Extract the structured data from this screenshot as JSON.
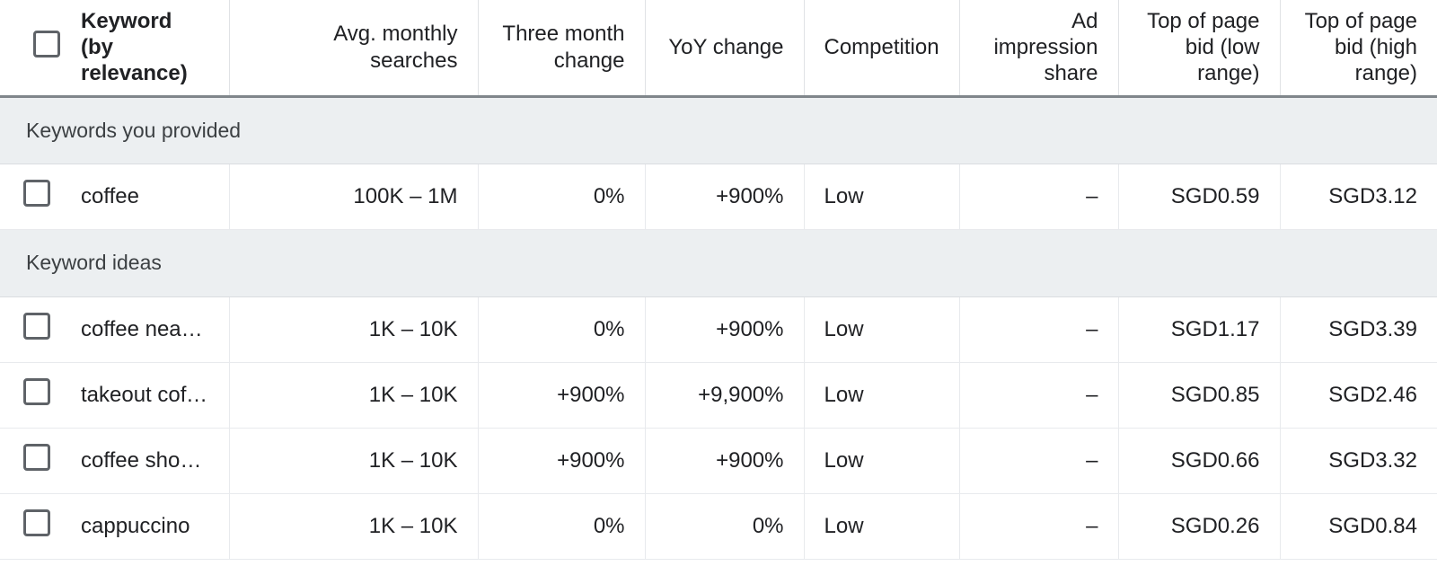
{
  "table": {
    "select_all_checkbox": "unchecked",
    "columns": [
      {
        "id": "checkbox",
        "label": "",
        "align": "left"
      },
      {
        "id": "keyword",
        "label": "Keyword (by relevance)",
        "align": "left"
      },
      {
        "id": "avg_searches",
        "label": "Avg. monthly searches",
        "align": "right"
      },
      {
        "id": "three_month",
        "label": "Three month change",
        "align": "right"
      },
      {
        "id": "yoy",
        "label": "YoY change",
        "align": "right"
      },
      {
        "id": "competition",
        "label": "Competition",
        "align": "left"
      },
      {
        "id": "ad_impression",
        "label": "Ad impression share",
        "align": "right"
      },
      {
        "id": "bid_low",
        "label": "Top of page bid (low range)",
        "align": "right"
      },
      {
        "id": "bid_high",
        "label": "Top of page bid (high range)",
        "align": "right"
      }
    ],
    "groups": [
      {
        "title": "Keywords you provided",
        "rows": [
          {
            "keyword": "coffee",
            "avg_searches": "100K – 1M",
            "three_month": "0%",
            "yoy": "+900%",
            "competition": "Low",
            "ad_impression": "–",
            "bid_low": "SGD0.59",
            "bid_high": "SGD3.12",
            "checkbox": "unchecked"
          }
        ]
      },
      {
        "title": "Keyword ideas",
        "rows": [
          {
            "keyword": "coffee near …",
            "avg_searches": "1K – 10K",
            "three_month": "0%",
            "yoy": "+900%",
            "competition": "Low",
            "ad_impression": "–",
            "bid_low": "SGD1.17",
            "bid_high": "SGD3.39",
            "checkbox": "unchecked"
          },
          {
            "keyword": "takeout coffe…",
            "avg_searches": "1K – 10K",
            "three_month": "+900%",
            "yoy": "+9,900%",
            "competition": "Low",
            "ad_impression": "–",
            "bid_low": "SGD0.85",
            "bid_high": "SGD2.46",
            "checkbox": "unchecked"
          },
          {
            "keyword": "coffee shops…",
            "avg_searches": "1K – 10K",
            "three_month": "+900%",
            "yoy": "+900%",
            "competition": "Low",
            "ad_impression": "–",
            "bid_low": "SGD0.66",
            "bid_high": "SGD3.32",
            "checkbox": "unchecked"
          },
          {
            "keyword": "cappuccino",
            "avg_searches": "1K – 10K",
            "three_month": "0%",
            "yoy": "0%",
            "competition": "Low",
            "ad_impression": "–",
            "bid_low": "SGD0.26",
            "bid_high": "SGD0.84",
            "checkbox": "unchecked"
          }
        ]
      }
    ]
  },
  "colors": {
    "group_band": "#eceff1",
    "header_rule": "#80868b",
    "grid_line": "#e8eaed",
    "text": "#202124"
  }
}
